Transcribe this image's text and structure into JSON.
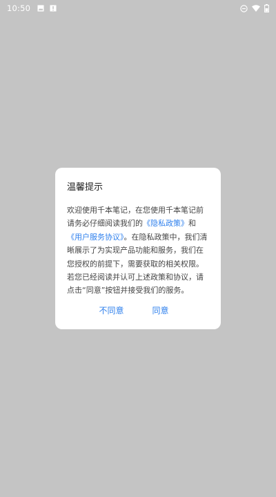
{
  "colors": {
    "overlay": "#c4c4c4",
    "accent": "#2f80ed",
    "text": "#444444"
  },
  "status_bar": {
    "time": "10:50",
    "left_icons": [
      "image-icon",
      "notification-icon"
    ],
    "right_icons": [
      "do-not-disturb-icon",
      "wifi-icon",
      "battery-icon"
    ]
  },
  "dialog": {
    "title": "温馨提示",
    "body": {
      "part1": "欢迎使用千本笔记，在您使用千本笔记前请务必仔细阅读我们的",
      "privacy_link": "《隐私政策》",
      "part2": "和",
      "terms_link": "《用户服务协议》",
      "part3": "。在隐私政策中，我们清晰展示了为实现产品功能和服务，我们在您授权的前提下，需要获取的相关权限。若您已经阅读并认可上述政策和协议，请点击“同意”按钮并接受我们的服务。"
    },
    "buttons": {
      "disagree": "不同意",
      "agree": "同意"
    }
  }
}
